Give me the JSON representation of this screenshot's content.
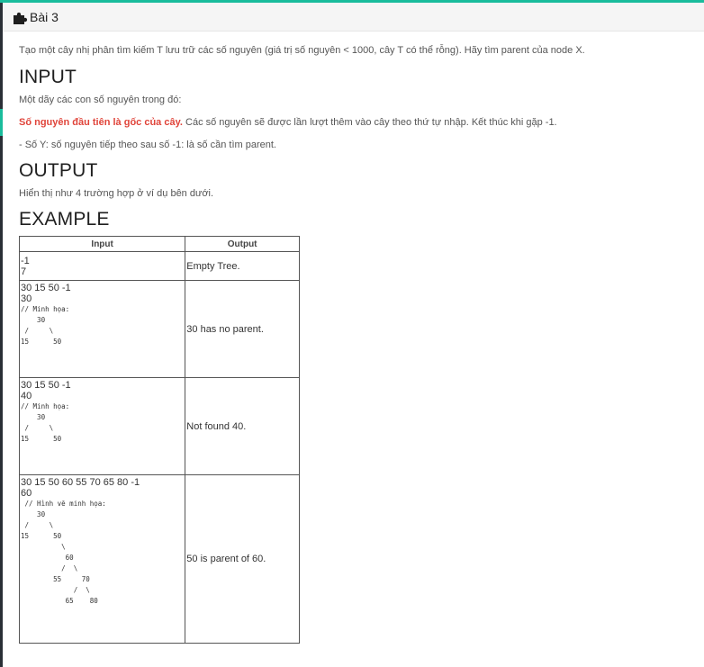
{
  "header": {
    "title": "Bài 3"
  },
  "problem": {
    "description": "Tạo một cây nhị phân tìm kiếm T lưu trữ các số nguyên (giá trị số nguyên < 1000, cây T có thể rỗng). Hãy tìm parent của node X.",
    "input_heading": "INPUT",
    "input_intro": "Một dãy các con số nguyên trong đó:",
    "input_rule_bold": "Số nguyên đầu tiên là gốc của cây.",
    "input_rule_rest": " Các số nguyên sẽ được lần lượt thêm vào cây theo thứ tự nhập. Kết thúc khi gặp -1.",
    "input_y": "- Số Y: số nguyên tiếp theo sau số -1: là số cần tìm parent.",
    "output_heading": "OUTPUT",
    "output_desc": "Hiển thị như 4 trường hợp ở ví dụ bên dưới.",
    "example_heading": "EXAMPLE"
  },
  "example_table": {
    "headers": [
      "Input",
      "Output"
    ],
    "rows": [
      {
        "input_lines": [
          "-1",
          "7"
        ],
        "illustration": "",
        "output": "Empty Tree."
      },
      {
        "input_lines": [
          "30 15 50 -1",
          "30"
        ],
        "illustration": "// Minh họa:\n    30\n /     \\\n15      50",
        "output": "30 has no parent."
      },
      {
        "input_lines": [
          "30 15 50 -1",
          "40"
        ],
        "illustration": "// Minh họa:\n    30\n /     \\\n15      50",
        "output": "Not found 40."
      },
      {
        "input_lines": [
          "30 15 50 60 55 70 65 80 -1",
          "60"
        ],
        "illustration": " // Hình vẽ minh họa:\n    30\n /     \\\n15      50\n          \\\n           60\n          /  \\\n        55     70\n             /  \\\n           65    80",
        "output": "50 is parent of 60."
      }
    ]
  },
  "colors": {
    "accent": "#1abc9c",
    "highlight": "#e0443a",
    "sidebar": "#2a2f36"
  }
}
